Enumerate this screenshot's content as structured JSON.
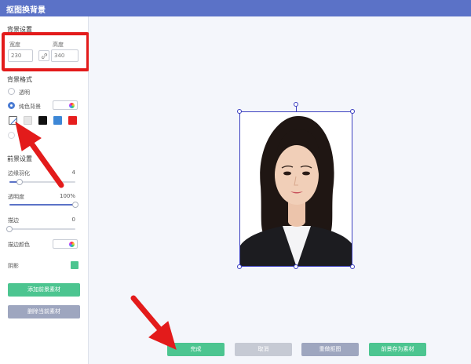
{
  "app": {
    "title": "抠图换背景"
  },
  "bg_size": {
    "section_title": "背景设置",
    "width_label": "宽度",
    "height_label": "高度",
    "width_value": "230",
    "height_value": "340",
    "link_icon": "link-icon"
  },
  "bg_format": {
    "section_title": "背景格式",
    "transparent_label": "透明",
    "solid_label": "纯色背景",
    "selected": "纯色背景",
    "swatch_colors": [
      "#ffffff",
      "#e6e6e6",
      "#111111",
      "#3d87d6",
      "#e61e1e"
    ]
  },
  "foreground": {
    "section_title": "前景设置",
    "feather": {
      "label": "边缘羽化",
      "value": "4",
      "fraction": 0.15
    },
    "opacity": {
      "label": "透明度",
      "value": "100%",
      "fraction": 1.0
    },
    "stroke": {
      "label": "描边",
      "value": "0",
      "fraction": 0.0
    },
    "stroke_color_label": "描边颜色",
    "shadow_label": "阴影",
    "shadow_enabled": true
  },
  "panel_buttons": {
    "add_label": "添加前景素材",
    "delete_label": "删除当前素材"
  },
  "bottom_buttons": {
    "done_label": "完成",
    "cancel_label": "取消",
    "redo_label": "重做抠图",
    "save_label": "前景存为素材"
  },
  "colors": {
    "accent": "#5b72c7",
    "green": "#4cc590",
    "annotation_red": "#e31b1b"
  }
}
